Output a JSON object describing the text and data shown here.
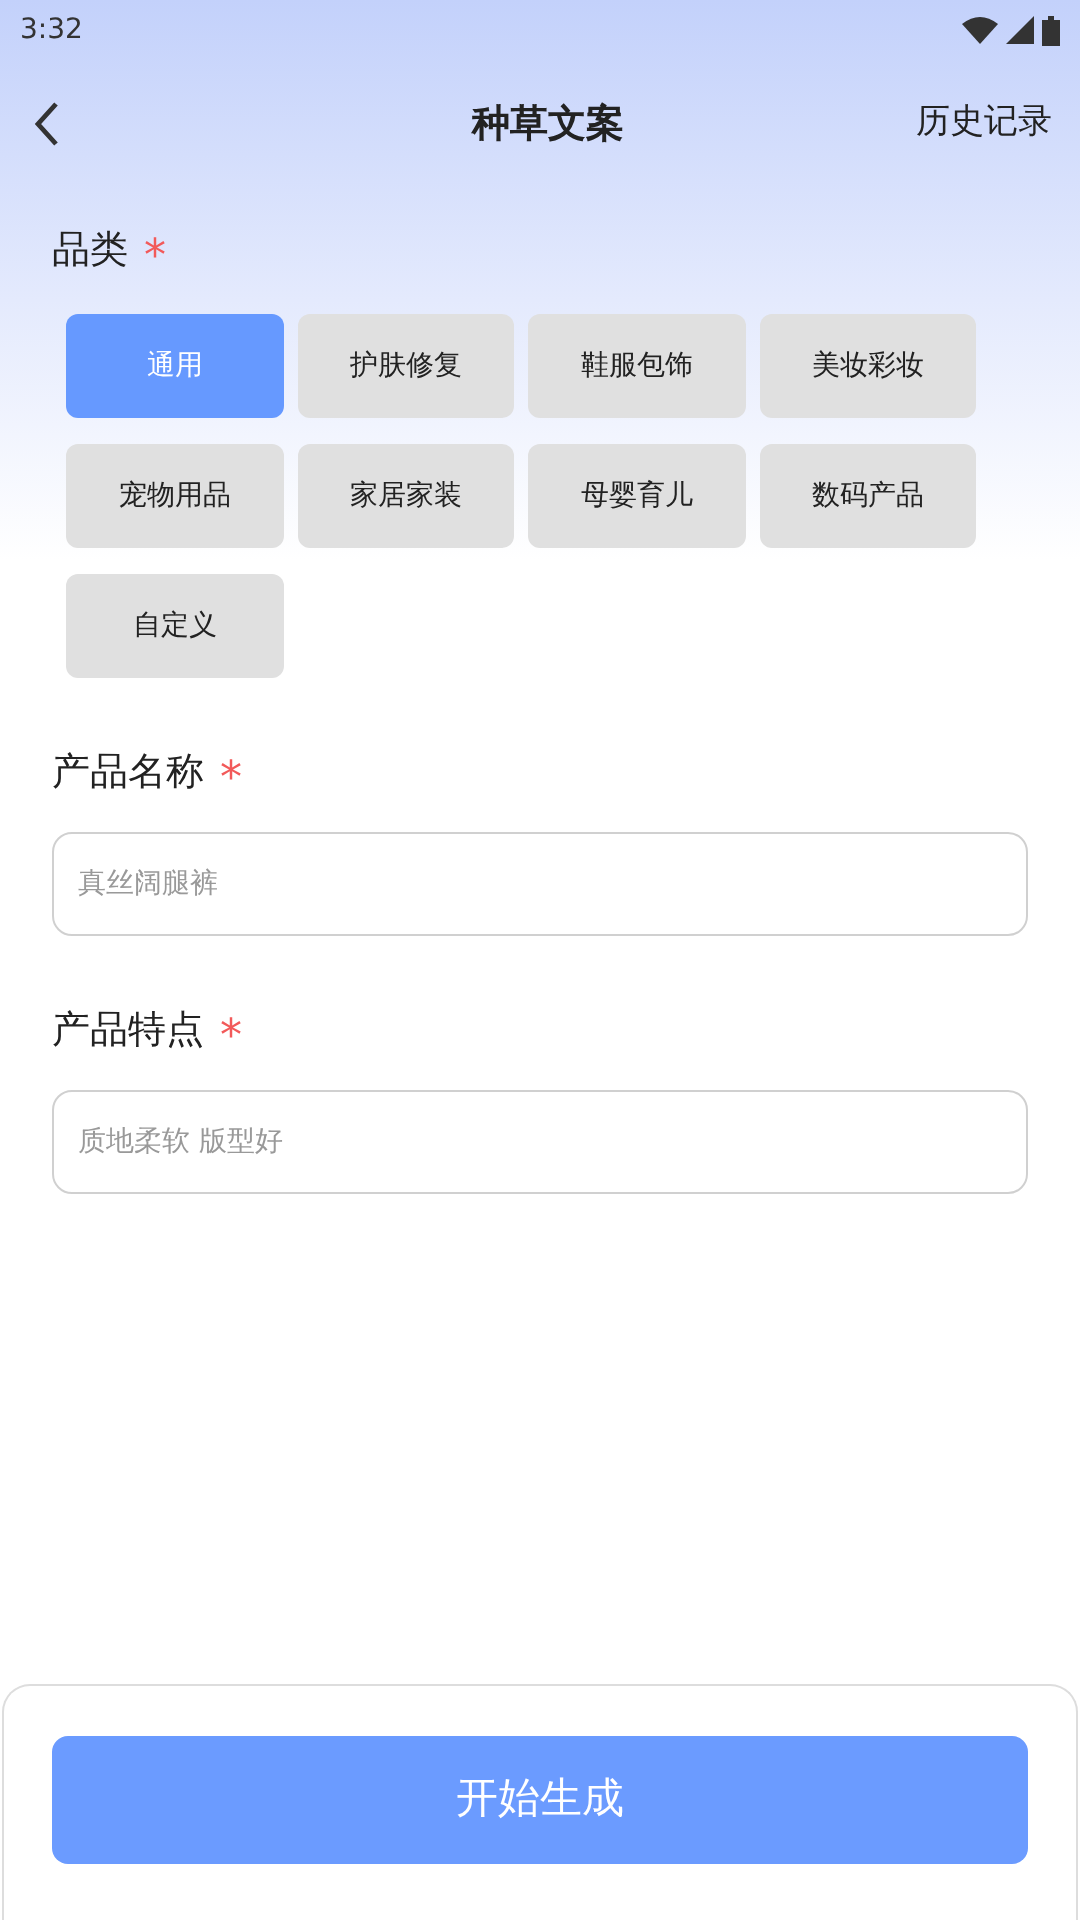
{
  "status_bar": {
    "time": "3:32"
  },
  "header": {
    "title": "种草文案",
    "action": "历史记录"
  },
  "category": {
    "label": "品类",
    "mark": "*",
    "options": [
      {
        "label": "通用",
        "selected": true
      },
      {
        "label": "护肤修复",
        "selected": false
      },
      {
        "label": "鞋服包饰",
        "selected": false
      },
      {
        "label": "美妆彩妆",
        "selected": false
      },
      {
        "label": "宠物用品",
        "selected": false
      },
      {
        "label": "家居家装",
        "selected": false
      },
      {
        "label": "母婴育儿",
        "selected": false
      },
      {
        "label": "数码产品",
        "selected": false
      },
      {
        "label": "自定义",
        "selected": false
      }
    ]
  },
  "fields": [
    {
      "label": "产品名称",
      "mark": "*",
      "placeholder": "真丝阔腿裤"
    },
    {
      "label": "产品特点",
      "mark": "*",
      "placeholder": "质地柔软 版型好"
    }
  ],
  "submit": "开始生成"
}
